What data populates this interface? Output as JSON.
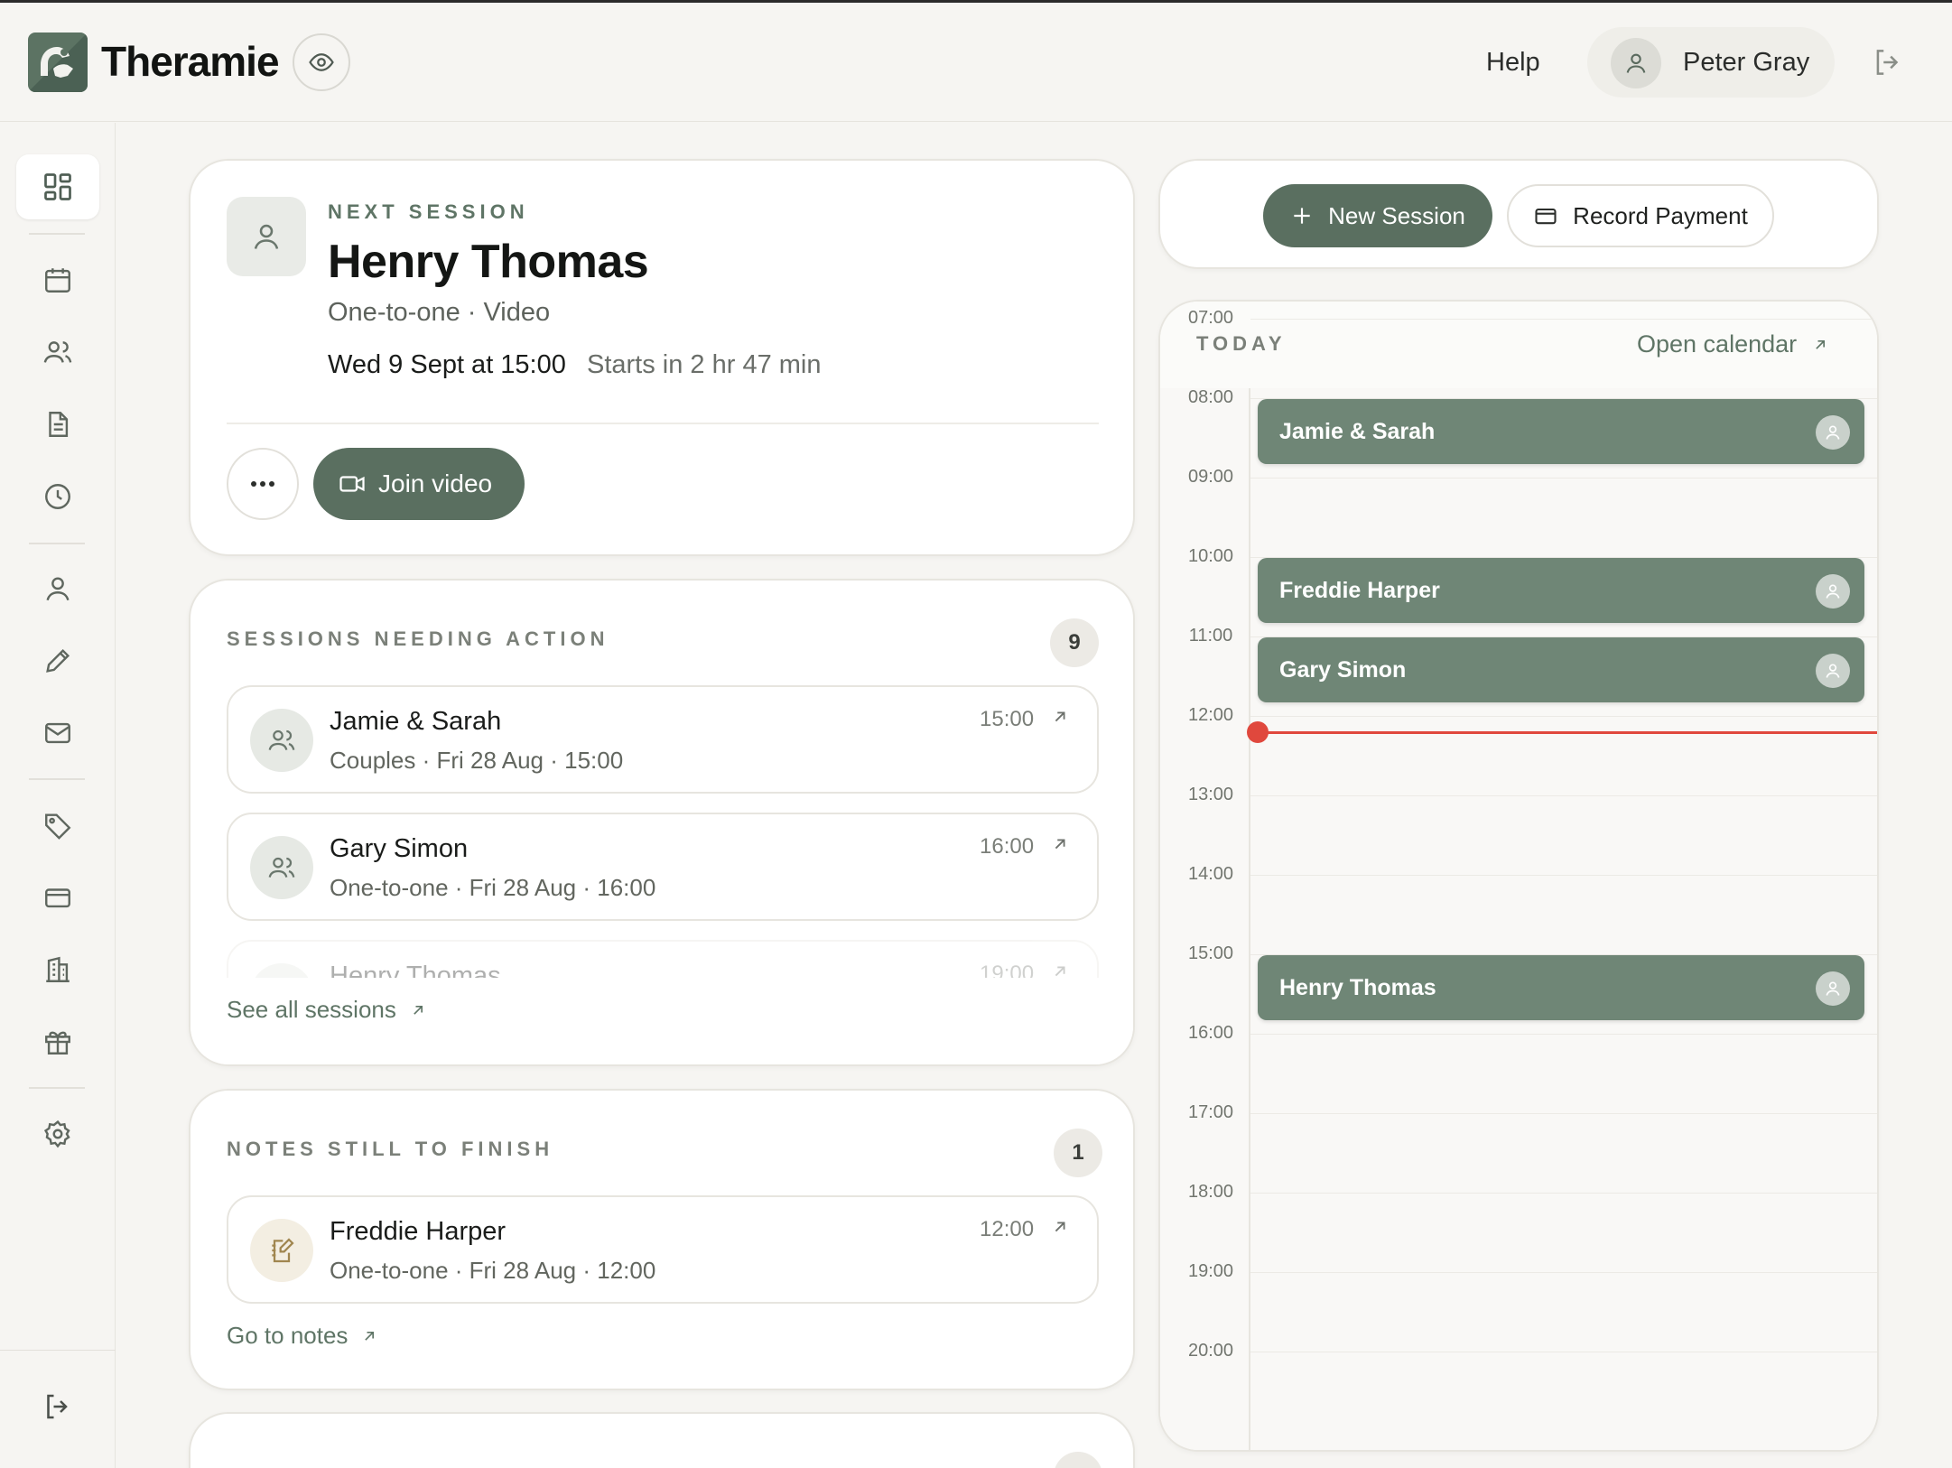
{
  "app": {
    "name": "Theramie"
  },
  "header": {
    "help_label": "Help",
    "user_name": "Peter Gray"
  },
  "sidebar": {
    "items": [
      "dashboard-icon",
      "calendar-icon",
      "clients-icon",
      "notes-icon",
      "history-icon",
      "profile-icon",
      "edit-icon",
      "mail-icon",
      "tag-icon",
      "card-icon",
      "building-icon",
      "gift-icon",
      "settings-icon",
      "logout-icon"
    ]
  },
  "next_session": {
    "eyebrow": "Next Session",
    "client": "Henry Thomas",
    "type": "One-to-one · Video",
    "when": "Wed 9 Sept at 15:00",
    "starts_in": "Starts in 2 hr 47 min",
    "join_label": "Join video"
  },
  "sessions_action": {
    "title": "Sessions Needing Action",
    "count": "9",
    "items": [
      {
        "name": "Jamie & Sarah",
        "sub": "Couples · Fri 28 Aug · 15:00",
        "time": "15:00"
      },
      {
        "name": "Gary Simon",
        "sub": "One-to-one · Fri 28 Aug · 16:00",
        "time": "16:00"
      },
      {
        "name": "Henry Thomas",
        "sub": "",
        "time": "19:00"
      }
    ],
    "link": "See all sessions"
  },
  "notes": {
    "title": "Notes Still To Finish",
    "count": "1",
    "items": [
      {
        "name": "Freddie Harper",
        "sub": "One-to-one · Fri 28 Aug · 12:00",
        "time": "12:00"
      }
    ],
    "link": "Go to notes"
  },
  "actions": {
    "new_session": "New Session",
    "record_payment": "Record Payment"
  },
  "calendar": {
    "title": "Today",
    "open_label": "Open calendar",
    "hours": [
      "07:00",
      "08:00",
      "09:00",
      "10:00",
      "11:00",
      "12:00",
      "13:00",
      "14:00",
      "15:00",
      "16:00",
      "17:00",
      "18:00",
      "19:00",
      "20:00"
    ],
    "current_time": "12:12",
    "events": [
      {
        "name": "Jamie & Sarah",
        "start": "08:00"
      },
      {
        "name": "Freddie Harper",
        "start": "10:00"
      },
      {
        "name": "Gary Simon",
        "start": "11:00"
      },
      {
        "name": "Henry Thomas",
        "start": "15:00"
      }
    ]
  },
  "colors": {
    "brand": "#5a6f60",
    "event": "#6f8676",
    "now_line": "#e0483d",
    "background": "#f6f5f2"
  }
}
